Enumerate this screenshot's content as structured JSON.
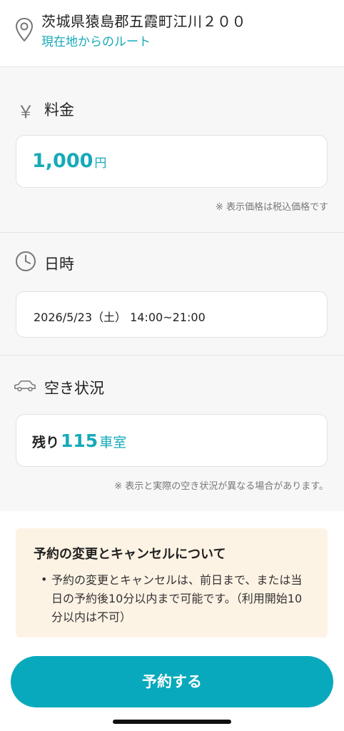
{
  "address": {
    "text": "茨城県猿島郡五霞町江川２００",
    "route_link": "現在地からのルート",
    "icon": "map-pin-icon"
  },
  "fee": {
    "icon": "yen-icon",
    "icon_glyph": "￥",
    "title": "料金",
    "amount": "1,000",
    "unit": "円",
    "note": "※ 表示価格は税込価格です"
  },
  "datetime": {
    "icon": "clock-icon",
    "title": "日時",
    "value": "2026/5/23（土） 14:00~21:00"
  },
  "availability": {
    "icon": "car-icon",
    "title": "空き状況",
    "prefix": "残り",
    "count": "115",
    "unit": "車室",
    "note": "※ 表示と実際の空き状況が異なる場合があります。"
  },
  "info": {
    "title": "予約の変更とキャンセルについて",
    "bullet": "•",
    "text": "予約の変更とキャンセルは、前日まで、または当日の予約後10分以内まで可能です。（利用開始10分以内は不可）"
  },
  "actions": {
    "reserve_label": "予約する"
  },
  "colors": {
    "accent": "#16aab8",
    "button": "#08a9bd",
    "info_bg": "#fdf3e5"
  }
}
